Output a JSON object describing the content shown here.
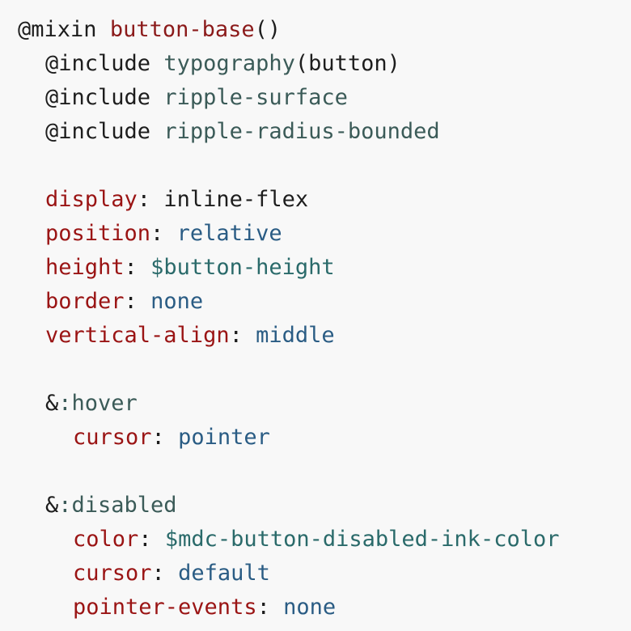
{
  "code": {
    "mixin": {
      "keyword": "@mixin",
      "name": "button-base",
      "parens": "()"
    },
    "includes": [
      {
        "keyword": "@include",
        "name": "typography",
        "args": "(button)"
      },
      {
        "keyword": "@include",
        "name": "ripple-surface",
        "args": ""
      },
      {
        "keyword": "@include",
        "name": "ripple-radius-bounded",
        "args": ""
      }
    ],
    "declarations": [
      {
        "property": "display",
        "value": "inline-flex",
        "value_kind": "plain"
      },
      {
        "property": "position",
        "value": "relative",
        "value_kind": "keyword"
      },
      {
        "property": "height",
        "value": "$button-height",
        "value_kind": "variable"
      },
      {
        "property": "border",
        "value": "none",
        "value_kind": "keyword"
      },
      {
        "property": "vertical-align",
        "value": "middle",
        "value_kind": "keyword"
      }
    ],
    "hover": {
      "amp": "&",
      "pseudo": ":hover",
      "declarations": [
        {
          "property": "cursor",
          "value": "pointer",
          "value_kind": "keyword"
        }
      ]
    },
    "disabled": {
      "amp": "&",
      "pseudo": ":disabled",
      "declarations": [
        {
          "property": "color",
          "value": "$mdc-button-disabled-ink-color",
          "value_kind": "variable"
        },
        {
          "property": "cursor",
          "value": "default",
          "value_kind": "keyword"
        },
        {
          "property": "pointer-events",
          "value": "none",
          "value_kind": "keyword"
        }
      ]
    },
    "colon": ":"
  },
  "colors": {
    "background": "#f8f8f8",
    "text": "#1d1d1d",
    "mixin_name": "#8b1a1a",
    "function_name": "#3b5b58",
    "property": "#9a1414",
    "value_keyword": "#2a5c84",
    "variable": "#2a6a6a"
  }
}
